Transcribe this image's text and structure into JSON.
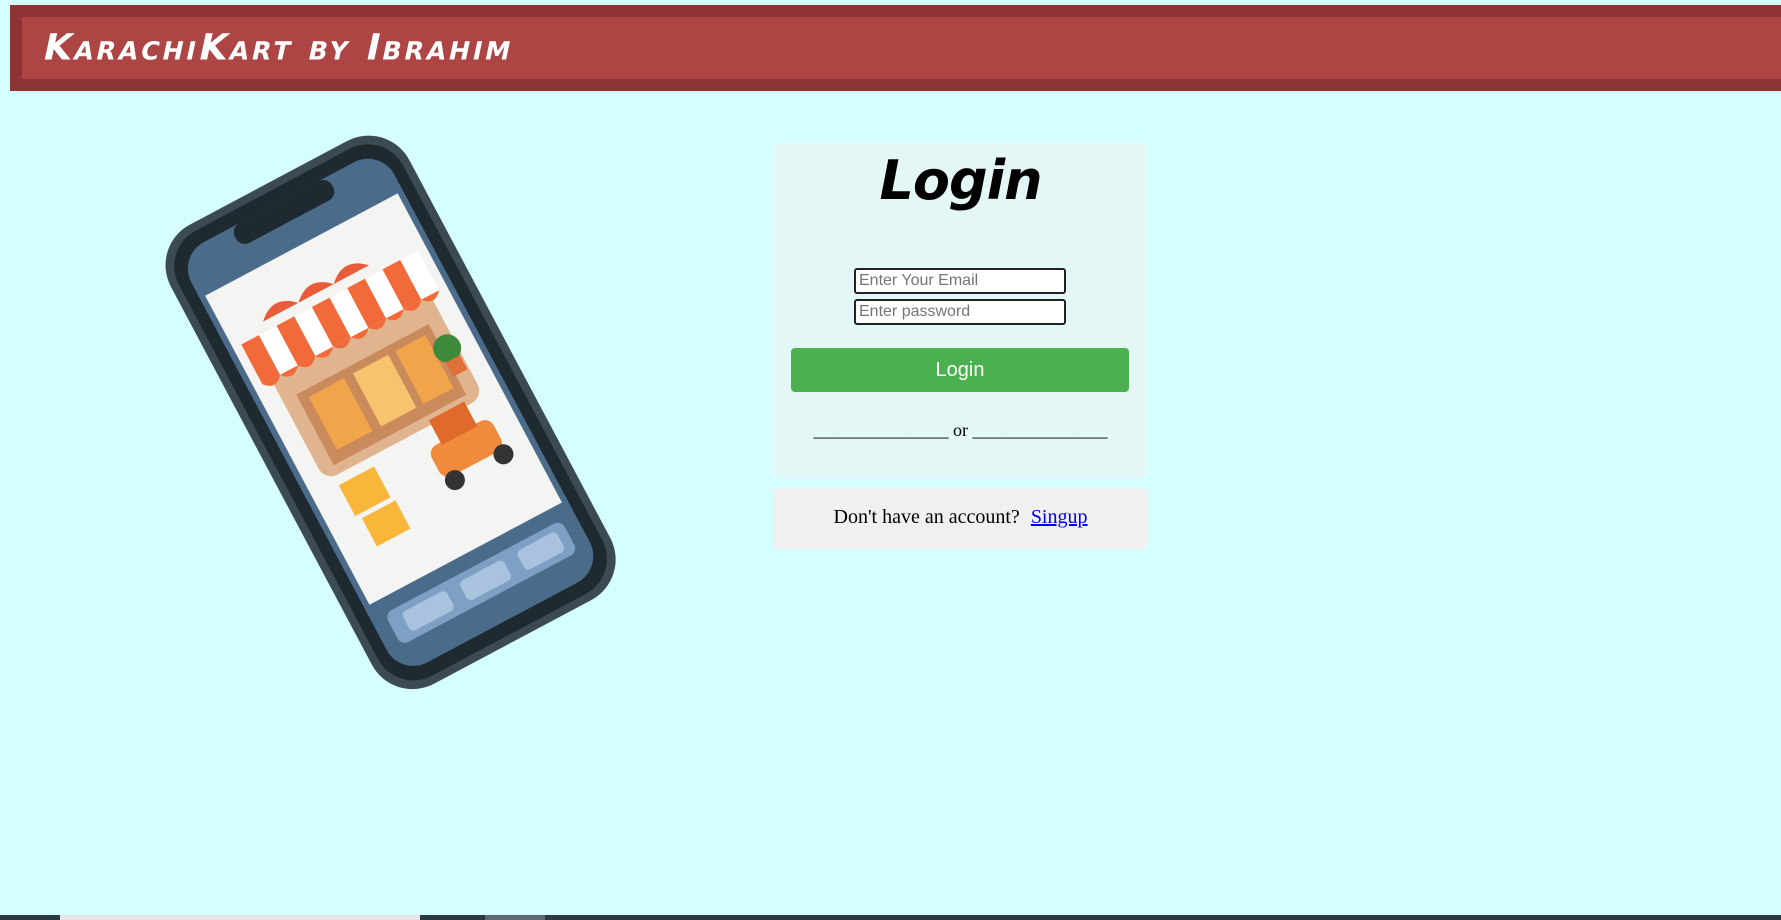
{
  "header": {
    "brand": "KarachiKart by Ibrahim"
  },
  "hero": {
    "image": "phone-shop-illustration"
  },
  "login": {
    "title": "Login",
    "email_placeholder": "Enter Your Email",
    "password_placeholder": "Enter password",
    "button_label": "Login",
    "divider": "_______________ or _______________"
  },
  "signup": {
    "prompt": "Don't have an account?",
    "link_label": "Singup"
  },
  "colors": {
    "background": "#d4fffe",
    "header": "#ad4545",
    "button": "#4caf50"
  }
}
